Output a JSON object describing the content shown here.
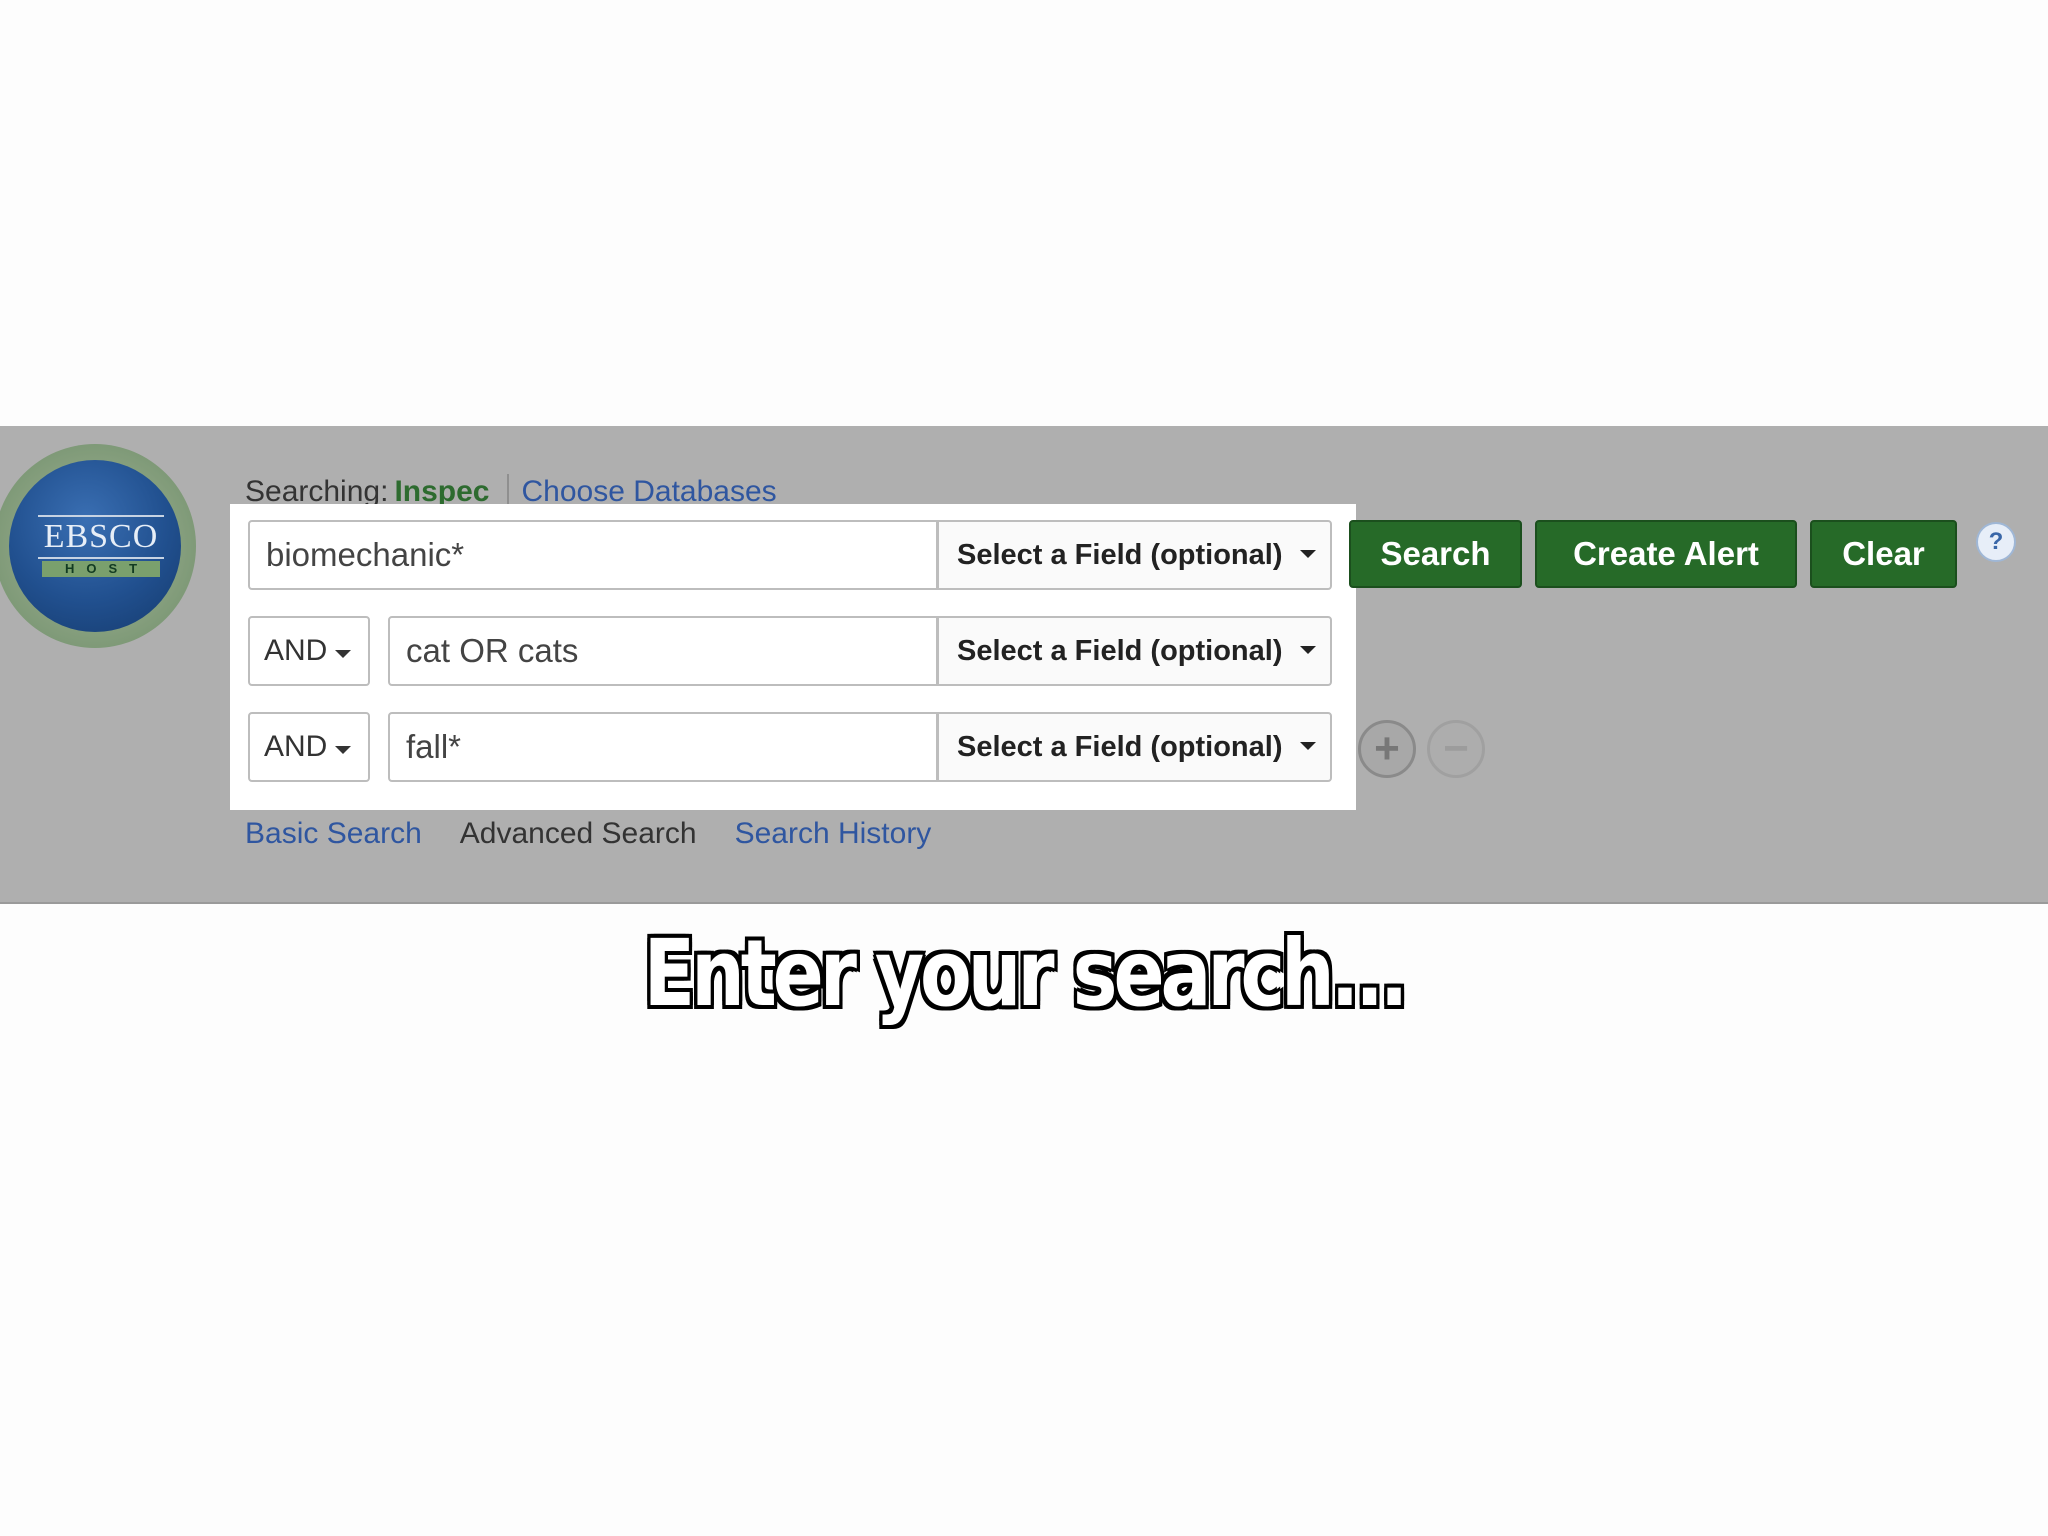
{
  "logo": {
    "text": "EBSCO",
    "sub": "HOST"
  },
  "searching": {
    "label": "Searching:",
    "database": "Inspec",
    "choose_link": "Choose Databases"
  },
  "rows": [
    {
      "operator": "",
      "term": "biomechanic*",
      "field": "Select a Field (optional)"
    },
    {
      "operator": "AND",
      "term": "cat OR cats",
      "field": "Select a Field (optional)"
    },
    {
      "operator": "AND",
      "term": "fall*",
      "field": "Select a Field (optional)"
    }
  ],
  "buttons": {
    "search": "Search",
    "create_alert": "Create Alert",
    "clear": "Clear",
    "help": "?",
    "add_row": "+",
    "remove_row": "−"
  },
  "links": {
    "basic": "Basic Search",
    "advanced": "Advanced Search",
    "history": "Search History"
  },
  "caption": "Enter your search...",
  "colors": {
    "button_green": "#266a28",
    "link_blue": "#2f56a0",
    "band_gray": "#afafaf"
  }
}
